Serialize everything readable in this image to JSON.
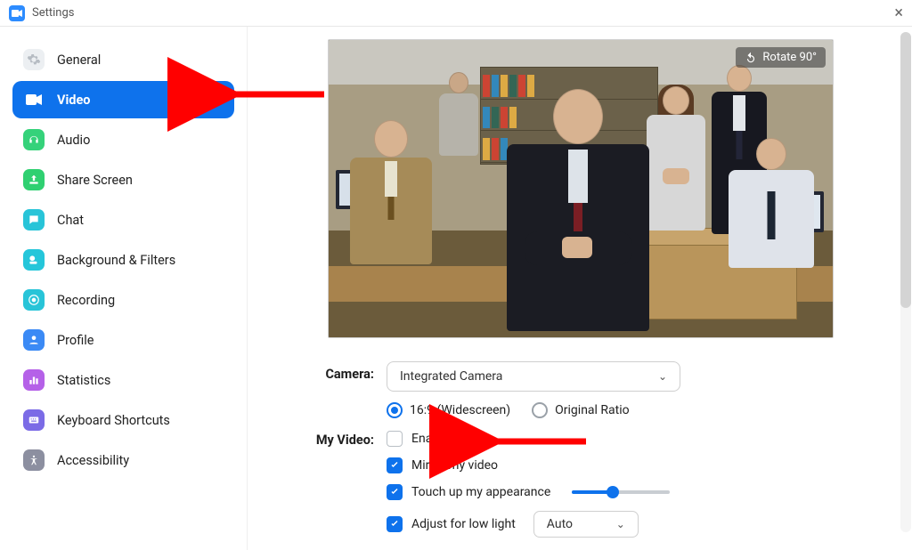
{
  "window": {
    "title": "Settings"
  },
  "sidebar": {
    "items": [
      {
        "label": "General"
      },
      {
        "label": "Video"
      },
      {
        "label": "Audio"
      },
      {
        "label": "Share Screen"
      },
      {
        "label": "Chat"
      },
      {
        "label": "Background & Filters"
      },
      {
        "label": "Recording"
      },
      {
        "label": "Profile"
      },
      {
        "label": "Statistics"
      },
      {
        "label": "Keyboard Shortcuts"
      },
      {
        "label": "Accessibility"
      }
    ],
    "active_index": 1
  },
  "preview": {
    "rotate_label": "Rotate 90°"
  },
  "form": {
    "camera_label": "Camera:",
    "camera_value": "Integrated Camera",
    "ratio_wide": "16:9 (Widescreen)",
    "ratio_original": "Original Ratio",
    "myvideo_label": "My Video:",
    "enable_hd": "Enable HD",
    "mirror": "Mirror my video",
    "touchup": "Touch up my appearance",
    "lowlight": "Adjust for low light",
    "lowlight_mode": "Auto"
  },
  "colors": {
    "accent": "#0e72ec"
  }
}
